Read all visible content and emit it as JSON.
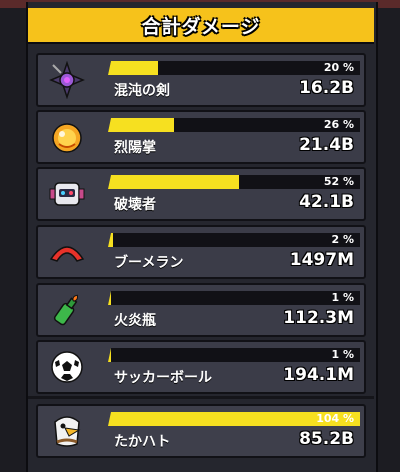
{
  "header": {
    "title": "合計ダメージ"
  },
  "colors": {
    "accent": "#f6c21b",
    "bar": "#f6e020",
    "row_bg": "#3b3c48"
  },
  "weapons": [
    {
      "icon": "dark-sword-icon",
      "name": "混沌の剣",
      "percent": "20 %",
      "fraction": 0.2,
      "damage": "16.2B"
    },
    {
      "icon": "sun-fireball-icon",
      "name": "烈陽掌",
      "percent": "26 %",
      "fraction": 0.26,
      "damage": "21.4B"
    },
    {
      "icon": "robot-drone-icon",
      "name": "破壊者",
      "percent": "52 %",
      "fraction": 0.52,
      "damage": "42.1B"
    },
    {
      "icon": "boomerang-icon",
      "name": "ブーメラン",
      "percent": "2 %",
      "fraction": 0.02,
      "damage": "1497M"
    },
    {
      "icon": "molotov-bottle-icon",
      "name": "火炎瓶",
      "percent": "1 %",
      "fraction": 0.01,
      "damage": "112.3M"
    },
    {
      "icon": "soccer-ball-icon",
      "name": "サッカーボール",
      "percent": "1 %",
      "fraction": 0.01,
      "damage": "194.1M"
    }
  ],
  "pet": {
    "icon": "eagle-pet-icon",
    "name": "たかハト",
    "percent": "104 %",
    "fraction": 1.0,
    "damage": "85.2B"
  }
}
